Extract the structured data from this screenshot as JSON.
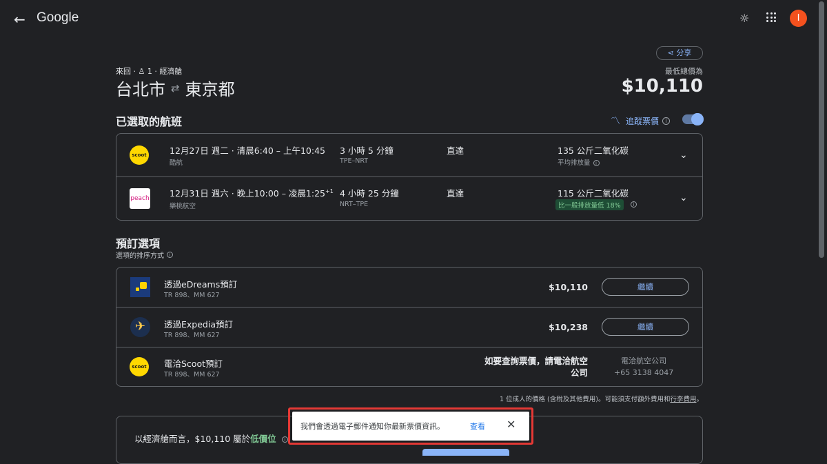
{
  "header": {
    "back_icon": "←",
    "logo": "Google",
    "theme_icon": "☼",
    "avatar_letter": "I",
    "avatar_color": "#f4511e"
  },
  "trip": {
    "share_label": "分享",
    "type": "來回",
    "passengers": "1",
    "cabin": "經濟艙",
    "origin": "台北市",
    "destination": "東京都",
    "lowest_label": "最低總價為",
    "lowest_price": "$10,110"
  },
  "selected": {
    "title": "已選取的航班",
    "track_label": "追蹤票價",
    "flights": [
      {
        "airline_logo": "scoot",
        "date_time": "12月27日 週二 · 清晨6:40 – 上午10:45",
        "plus_days": "",
        "airline": "酷航",
        "duration": "3 小時 5 分鐘",
        "route": "TPE–NRT",
        "stops": "直達",
        "emissions": "135 公斤二氧化碳",
        "emissions_note": "平均排放量"
      },
      {
        "airline_logo": "peach",
        "date_time": "12月31日 週六 · 晚上10:00 – 凌晨1:25",
        "plus_days": "+1",
        "airline": "樂桃航空",
        "duration": "4 小時 25 分鐘",
        "route": "NRT–TPE",
        "stops": "直達",
        "emissions": "115 公斤二氧化碳",
        "emissions_note": "比一般排放量低 18%"
      }
    ]
  },
  "booking": {
    "title": "預訂選項",
    "sort_label": "選項的排序方式",
    "options": [
      {
        "name": "透過eDreams預訂",
        "flights": "TR 898、MM 627",
        "price": "$10,110",
        "button": "繼續"
      },
      {
        "name": "透過Expedia預訂",
        "flights": "TR 898、MM 627",
        "price": "$10,238",
        "button": "繼續"
      },
      {
        "name": "電洽Scoot預訂",
        "flights": "TR 898、MM 627",
        "contact_line1": "如要查詢票價，請電洽航空",
        "contact_line2": "公司",
        "contact_label": "電洽航空公司",
        "phone": "+65 3138 4047"
      }
    ],
    "footnote_prefix": "1 位成人的價格 (含稅及其他費用)。可能須支付額外費用和",
    "footnote_link": "行李費用",
    "footnote_suffix": "。"
  },
  "insight": {
    "prefix": "以經濟艙而言，$10,110 屬於",
    "level": "低價位"
  },
  "toast": {
    "message": "我們會透過電子郵件通知你最新票價資訊。",
    "action": "查看",
    "close": "✕"
  },
  "colors": {
    "background": "#202124",
    "accent": "#8ab4f8",
    "low_price": "#81c995",
    "highlight": "#e53935"
  }
}
